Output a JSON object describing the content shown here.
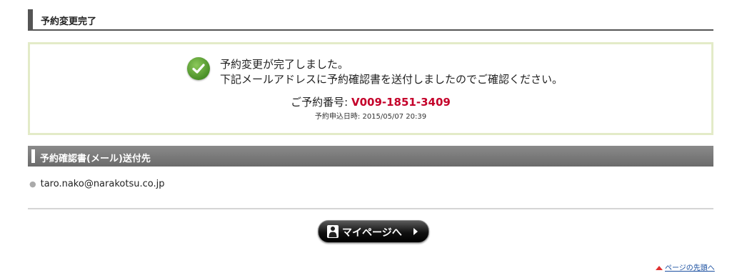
{
  "page": {
    "heading": "予約変更完了"
  },
  "confirmation": {
    "icon": "checkmark-icon",
    "accent_color": "#5aa332",
    "message_line1": "予約変更が完了しました。",
    "message_line2": "下記メールアドレスに予約確認書を送付しましたのでご確認ください。",
    "booking_label": "ご予約番号: ",
    "booking_number": "V009-1851-3409",
    "applied_at": "予約申込日時: 2015/05/07 20:39"
  },
  "recipient_section": {
    "heading": "予約確認書(メール)送付先",
    "emails": [
      "taro.nako@narakotsu.co.jp"
    ]
  },
  "actions": {
    "mypage_label": "マイページへ",
    "mypage_icon": "person-icon",
    "back_to_top_label": "ページの先頭へ",
    "back_to_top_icon": "arrow-up-icon"
  }
}
